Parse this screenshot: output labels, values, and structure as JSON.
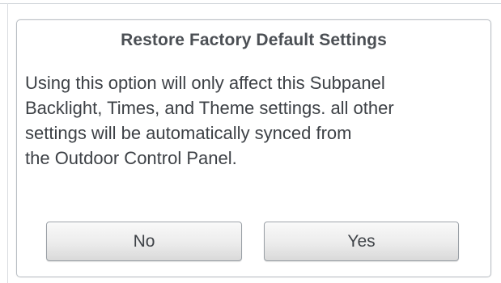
{
  "dialog": {
    "title": "Restore Factory Default Settings",
    "message_lines": [
      "Using this option will only affect this Subpanel",
      "Backlight, Times, and Theme settings. all other",
      "settings will be automatically synced from",
      "the Outdoor Control Panel."
    ],
    "buttons": {
      "no_label": "No",
      "yes_label": "Yes"
    }
  }
}
